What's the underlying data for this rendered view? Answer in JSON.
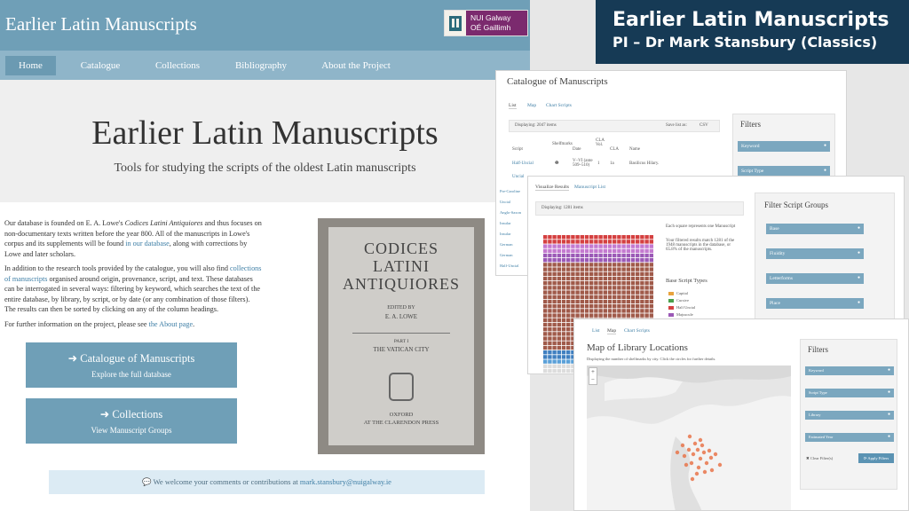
{
  "site": {
    "title": "Earlier Latin Manuscripts",
    "logo_line1": "NUI Galway",
    "logo_line2": "OÉ Gaillimh",
    "nav": [
      "Home",
      "Catalogue",
      "Collections",
      "Bibliography",
      "About the Project"
    ],
    "hero_title": "Earlier Latin Manuscripts",
    "hero_subtitle": "Tools for studying the scripts of the oldest Latin manuscripts",
    "intro": {
      "p1_a": "Our database is founded on E. A. Lowe's ",
      "p1_italic": "Codices Latini Antiquiores",
      "p1_b": " and thus focuses on non-documentary texts written before the year 800. All of the manuscripts in Lowe's corpus and its supplements will be found ",
      "p1_link": "in our database",
      "p1_c": ", along with corrections by Lowe and later scholars.",
      "p2_a": "In addition to the research tools provided by the catalogue, you will also find ",
      "p2_link": "collections of manuscripts",
      "p2_b": " organised around origin, provenance, script, and text. These databases can be interrogated in several ways: filtering by keyword, which searches the text of the entire database, by library, by script, or by date (or any combination of those filters). The results can then be sorted by clicking on any of the column headings.",
      "p3_a": "For further information on the project, please see ",
      "p3_link": "the About page",
      "p3_b": "."
    },
    "cta1_title": "Catalogue of Manuscripts",
    "cta1_sub": "Explore the full database",
    "cta2_title": "Collections",
    "cta2_sub": "View Manuscript Groups",
    "book": {
      "title1": "CODICES",
      "title2": "LATINI",
      "title3": "ANTIQUIORES",
      "edited": "EDITED BY",
      "editor": "E. A. LOWE",
      "part": "PART I",
      "vol": "THE VATICAN CITY",
      "pub1": "OXFORD",
      "pub2": "AT THE CLARENDON PRESS"
    },
    "comment_text": "We welcome your comments or contributions at ",
    "comment_email": "mark.stansbury@nuigalway.ie"
  },
  "pi_banner": {
    "line1": "Earlier Latin Manuscripts",
    "line2": "PI – Dr Mark Stansbury (Classics)"
  },
  "catalogue_shot": {
    "title": "Catalogue of Manuscripts",
    "tabs": [
      "List",
      "Map",
      "Chart Scripts"
    ],
    "displaying": "Displaying: 2047 items",
    "save_list": "Save list as:",
    "csv": "CSV",
    "columns": [
      "Script",
      "Shelfmarks",
      "Date",
      "CLA Vol.",
      "CLA",
      "Name"
    ],
    "rows": [
      [
        "Half-Uncial",
        "",
        "V–VI (ante 509–510)",
        "1",
        "1a",
        "Basilicus Hilary."
      ],
      [
        "Uncial",
        "",
        "",
        "",
        "",
        ""
      ]
    ],
    "side_labels": [
      "Pre-Caroline",
      "Uncial",
      "Anglo-Saxon",
      "Insular",
      "Insular",
      "German",
      "German",
      "Half-Uncial",
      "Uncial"
    ],
    "filters_title": "Filters",
    "filters": [
      "Keyword",
      "Script Type"
    ]
  },
  "viz_shot": {
    "tabs": [
      "Visualize Results",
      "Manuscript List"
    ],
    "displaying": "Displaying: 1281 items",
    "desc1": "Each square represents one Manuscript",
    "desc2": "Your filtered results match 1281 of the 1948 manuscripts in the database, or 65.8% of the manuscripts.",
    "legend_title": "Base Script Types",
    "legend": [
      {
        "label": "Capital",
        "color": "#e8a33d"
      },
      {
        "label": "Cursive",
        "color": "#4aa04a"
      },
      {
        "label": "Half Uncial",
        "color": "#d44040"
      },
      {
        "label": "Majuscule",
        "color": "#9b59b6"
      }
    ],
    "filters_title": "Filter Script Groups",
    "filters": [
      "Base",
      "Fluidity",
      "Letterforms",
      "Place"
    ]
  },
  "map_shot": {
    "tabs": [
      "List",
      "Map",
      "Chart Scripts"
    ],
    "title": "Map of Library Locations",
    "subtitle": "Displaying the number of shelfmarks by city. Click the circles for further details.",
    "zoom_in": "+",
    "zoom_out": "−",
    "filters_title": "Filters",
    "filters": [
      "Keyword",
      "Script Type",
      "Library",
      "Estimated Year"
    ],
    "clear": "Clear Filter(s)",
    "apply": "Apply Filters"
  }
}
